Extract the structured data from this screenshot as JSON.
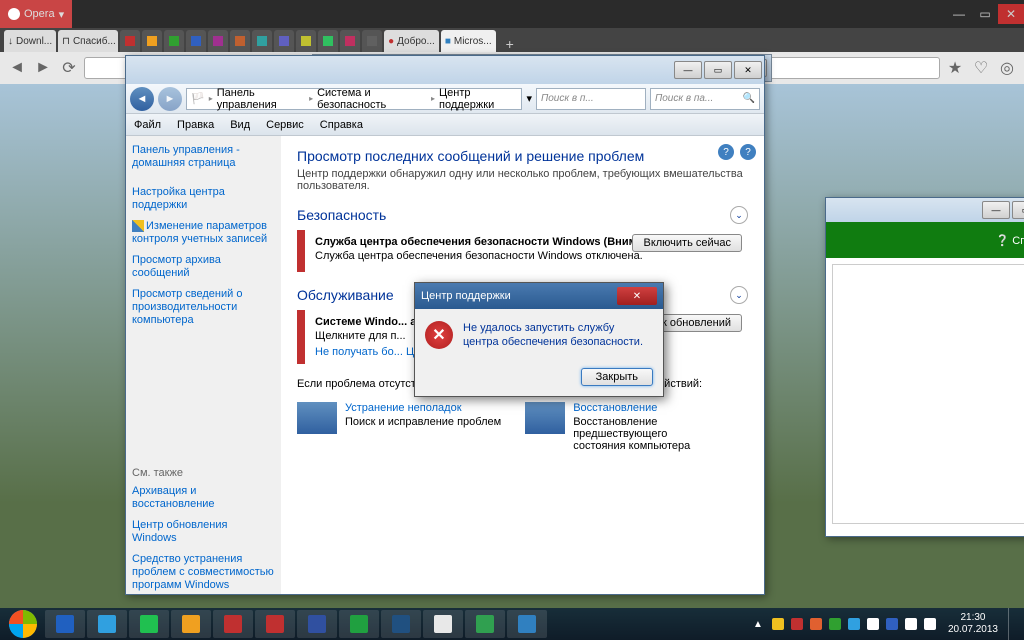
{
  "opera": {
    "label": "Opera"
  },
  "tabs": [
    {
      "icon": "↓",
      "label": "Downl..."
    },
    {
      "icon": "⊓",
      "label": "Спасиб..."
    }
  ],
  "miniTabColors": [
    "#c03030",
    "#f0a020",
    "#30a030",
    "#3060c0",
    "#a03090",
    "#c06030",
    "#30a0a0",
    "#6060c0",
    "#c0c030",
    "#30c060",
    "#c03060",
    "#606060"
  ],
  "tabsRight": [
    {
      "icon": "●",
      "label": "Добро..."
    },
    {
      "icon": "■",
      "label": "Micros..."
    }
  ],
  "addr": {
    "url": ""
  },
  "cp": {
    "breadcrumb": [
      "Панель управления",
      "Система и безопасность",
      "Центр поддержки"
    ],
    "searchPlaceholder1": "Поиск в п...",
    "searchPlaceholder2": "Поиск в па...",
    "menu": [
      "Файл",
      "Правка",
      "Вид",
      "Сервис",
      "Справка"
    ],
    "side": {
      "home": "Панель управления - домашняя страница",
      "l1": "Настройка центра поддержки",
      "l2": "Изменение параметров контроля учетных записей",
      "l3": "Просмотр архива сообщений",
      "l4": "Просмотр сведений о производительности компьютера",
      "seeAlso": "См. также",
      "s1": "Архивация и восстановление",
      "s2": "Центр обновления Windows",
      "s3": "Средство устранения проблем с совместимостью программ Windows"
    },
    "main": {
      "title": "Просмотр последних сообщений и решение проблем",
      "sub": "Центр поддержки обнаружил одну или несколько проблем, требующих вмешательства пользователя.",
      "sec1": "Безопасность",
      "a1Title": "Служба центра обеспечения безопасности Windows  (Внимание!)",
      "a1Text": "Служба центра обеспечения безопасности Windows отключена.",
      "a1Btn": "Включить сейчас",
      "sec2": "Обслуживание",
      "a2Title": "Системе Windo... автоматич... (Внимание!)",
      "a2Text": "Щелкните для п...",
      "a2Link": "Не получать бо... Центра обновле...",
      "a2Btn": "ск обновлений",
      "noProb": "Если проблема отсутствует в списке, выполните одно из следующих действий:",
      "act1Title": "Устранение неполадок",
      "act1Text": "Поиск и исправление проблем",
      "act2Title": "Восстановление",
      "act2Text": "Восстановление предшествующего состояния компьютера"
    }
  },
  "dialog": {
    "title": "Центр поддержки",
    "text": "Не удалось запустить службу центра обеспечения безопасности.",
    "close": "Закрыть"
  },
  "mse": {
    "help": "Справка"
  },
  "clock": {
    "time": "21:30",
    "date": "20.07.2013"
  },
  "taskIcons": [
    "#2060c0",
    "#30a0e0",
    "#20c050",
    "#f0a020",
    "#c03030",
    "#c03030",
    "#3050a0",
    "#20a040",
    "#205080",
    "#e8e8e8",
    "#30a050",
    "#3080c0"
  ],
  "trayColors": [
    "#f0c020",
    "#c03030",
    "#e06030",
    "#30a030",
    "#30a0e0",
    "#fff",
    "#3060c0",
    "#fff",
    "#fff"
  ]
}
